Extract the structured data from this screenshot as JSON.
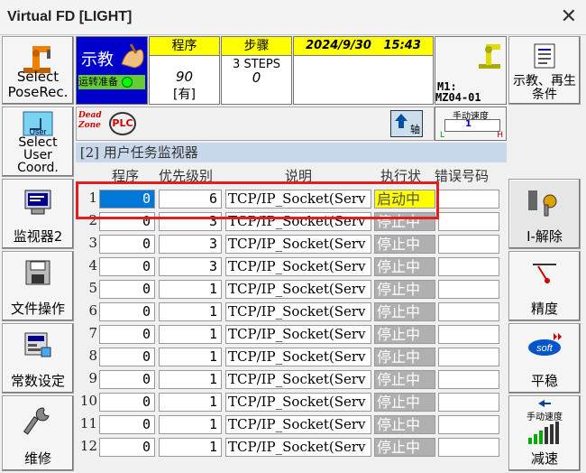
{
  "window": {
    "title": "Virtual FD [LIGHT]",
    "close_glyph": "✕"
  },
  "left_buttons": [
    {
      "label": "Select\nPoseRec.",
      "icon": "robot-arm-icon"
    },
    {
      "label": "Select\nUser\nCoord.",
      "icon": "user-coord-icon",
      "small": "User"
    },
    {
      "label": "监视器2",
      "icon": "monitor-icon"
    },
    {
      "label": "文件操作",
      "icon": "floppy-disk-icon"
    },
    {
      "label": "常数设定",
      "icon": "constant-settings-icon"
    },
    {
      "label": "维修",
      "icon": "wrench-icon"
    }
  ],
  "right_buttons": [
    {
      "label": "示教、再生\n条件",
      "icon": "document-icon"
    },
    {
      "label": "I-解除",
      "icon": "interlock-release-icon"
    },
    {
      "label": "精度",
      "icon": "accuracy-icon"
    },
    {
      "label": "平稳",
      "icon": "soft-icon",
      "small": "soft"
    },
    {
      "label": "减速",
      "icon": "manual-speed-bars-icon",
      "small": "手动速度"
    }
  ],
  "status": {
    "mode": "示教",
    "ready": "运转准备",
    "program_header": "程序",
    "program_number": "90",
    "program_flag": "[有]",
    "step_header": "步骤",
    "steps_count": "3 STEPS",
    "step_current": "0",
    "datetime": "2024/9/30   15:43",
    "mechanism": "M1:",
    "model": "MZ04-01",
    "speed_label": "手动速度",
    "speed_low": "L",
    "speed_value": "1",
    "speed_high": "H"
  },
  "toolbar": {
    "deadzone": "Dead\nZone",
    "plc": "PLC",
    "axis": "轴"
  },
  "monitor": {
    "title": "[2] 用户任务监视器",
    "headers": {
      "program": "程序",
      "priority": "优先级别",
      "desc": "说明",
      "state": "执行状",
      "error": "错误号码"
    },
    "rows": [
      {
        "n": "1",
        "prog": "0",
        "prio": "6",
        "desc": "TCP/IP_Socket(Serv",
        "state": "启动中",
        "running": true
      },
      {
        "n": "2",
        "prog": "0",
        "prio": "3",
        "desc": "TCP/IP_Socket(Serv",
        "state": "停止中",
        "running": false
      },
      {
        "n": "3",
        "prog": "0",
        "prio": "3",
        "desc": "TCP/IP_Socket(Serv",
        "state": "停止中",
        "running": false
      },
      {
        "n": "4",
        "prog": "0",
        "prio": "3",
        "desc": "TCP/IP_Socket(Serv",
        "state": "停止中",
        "running": false
      },
      {
        "n": "5",
        "prog": "0",
        "prio": "1",
        "desc": "TCP/IP_Socket(Serv",
        "state": "停止中",
        "running": false
      },
      {
        "n": "6",
        "prog": "0",
        "prio": "1",
        "desc": "TCP/IP_Socket(Serv",
        "state": "停止中",
        "running": false
      },
      {
        "n": "7",
        "prog": "0",
        "prio": "1",
        "desc": "TCP/IP_Socket(Serv",
        "state": "停止中",
        "running": false
      },
      {
        "n": "8",
        "prog": "0",
        "prio": "1",
        "desc": "TCP/IP_Socket(Serv",
        "state": "停止中",
        "running": false
      },
      {
        "n": "9",
        "prog": "0",
        "prio": "1",
        "desc": "TCP/IP_Socket(Serv",
        "state": "停止中",
        "running": false
      },
      {
        "n": "10",
        "prog": "0",
        "prio": "1",
        "desc": "TCP/IP_Socket(Serv",
        "state": "停止中",
        "running": false
      },
      {
        "n": "11",
        "prog": "0",
        "prio": "1",
        "desc": "TCP/IP_Socket(Serv",
        "state": "停止中",
        "running": false
      },
      {
        "n": "12",
        "prog": "0",
        "prio": "1",
        "desc": "TCP/IP_Socket(Serv",
        "state": "停止中",
        "running": false
      }
    ]
  },
  "colors": {
    "accent_blue": "#0078d7",
    "highlight_yellow": "#ffff00",
    "teach_blue": "#0000cc",
    "alert_red": "#e02020"
  }
}
